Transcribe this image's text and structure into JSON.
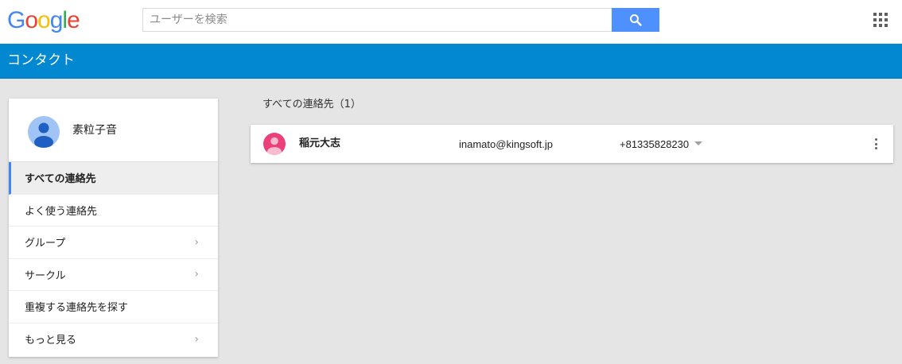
{
  "header": {
    "logo": {
      "letters": [
        {
          "ch": "G",
          "color": "#4285f4"
        },
        {
          "ch": "o",
          "color": "#ea4335"
        },
        {
          "ch": "o",
          "color": "#fbbc05"
        },
        {
          "ch": "g",
          "color": "#4285f4"
        },
        {
          "ch": "l",
          "color": "#34a853"
        },
        {
          "ch": "e",
          "color": "#ea4335"
        }
      ]
    },
    "search": {
      "placeholder": "ユーザーを検索",
      "value": "",
      "button_icon": "search-icon",
      "button_color": "#4d90fe"
    },
    "apps_icon": "apps-grid-icon"
  },
  "appbar": {
    "title": "コンタクト",
    "color": "#0288d1"
  },
  "sidebar": {
    "profile": {
      "name": "素粒子音",
      "avatar_icon": "user-avatar-icon",
      "avatar_color": "#9fc4f5"
    },
    "items": [
      {
        "label": "すべての連絡先",
        "active": true,
        "has_chevron": false
      },
      {
        "label": "よく使う連絡先",
        "active": false,
        "has_chevron": false
      },
      {
        "label": "グループ",
        "active": false,
        "has_chevron": true
      },
      {
        "label": "サークル",
        "active": false,
        "has_chevron": true
      },
      {
        "label": "重複する連絡先を探す",
        "active": false,
        "has_chevron": false
      },
      {
        "label": "もっと見る",
        "active": false,
        "has_chevron": true
      }
    ],
    "active_accent": "#4285f4"
  },
  "main": {
    "section_title": "すべての連絡先（1）",
    "contacts": [
      {
        "name": "稲元大志",
        "email": "inamato@kingsoft.jp",
        "phone": "+81335828230",
        "avatar_color": "#ec407a"
      }
    ]
  }
}
